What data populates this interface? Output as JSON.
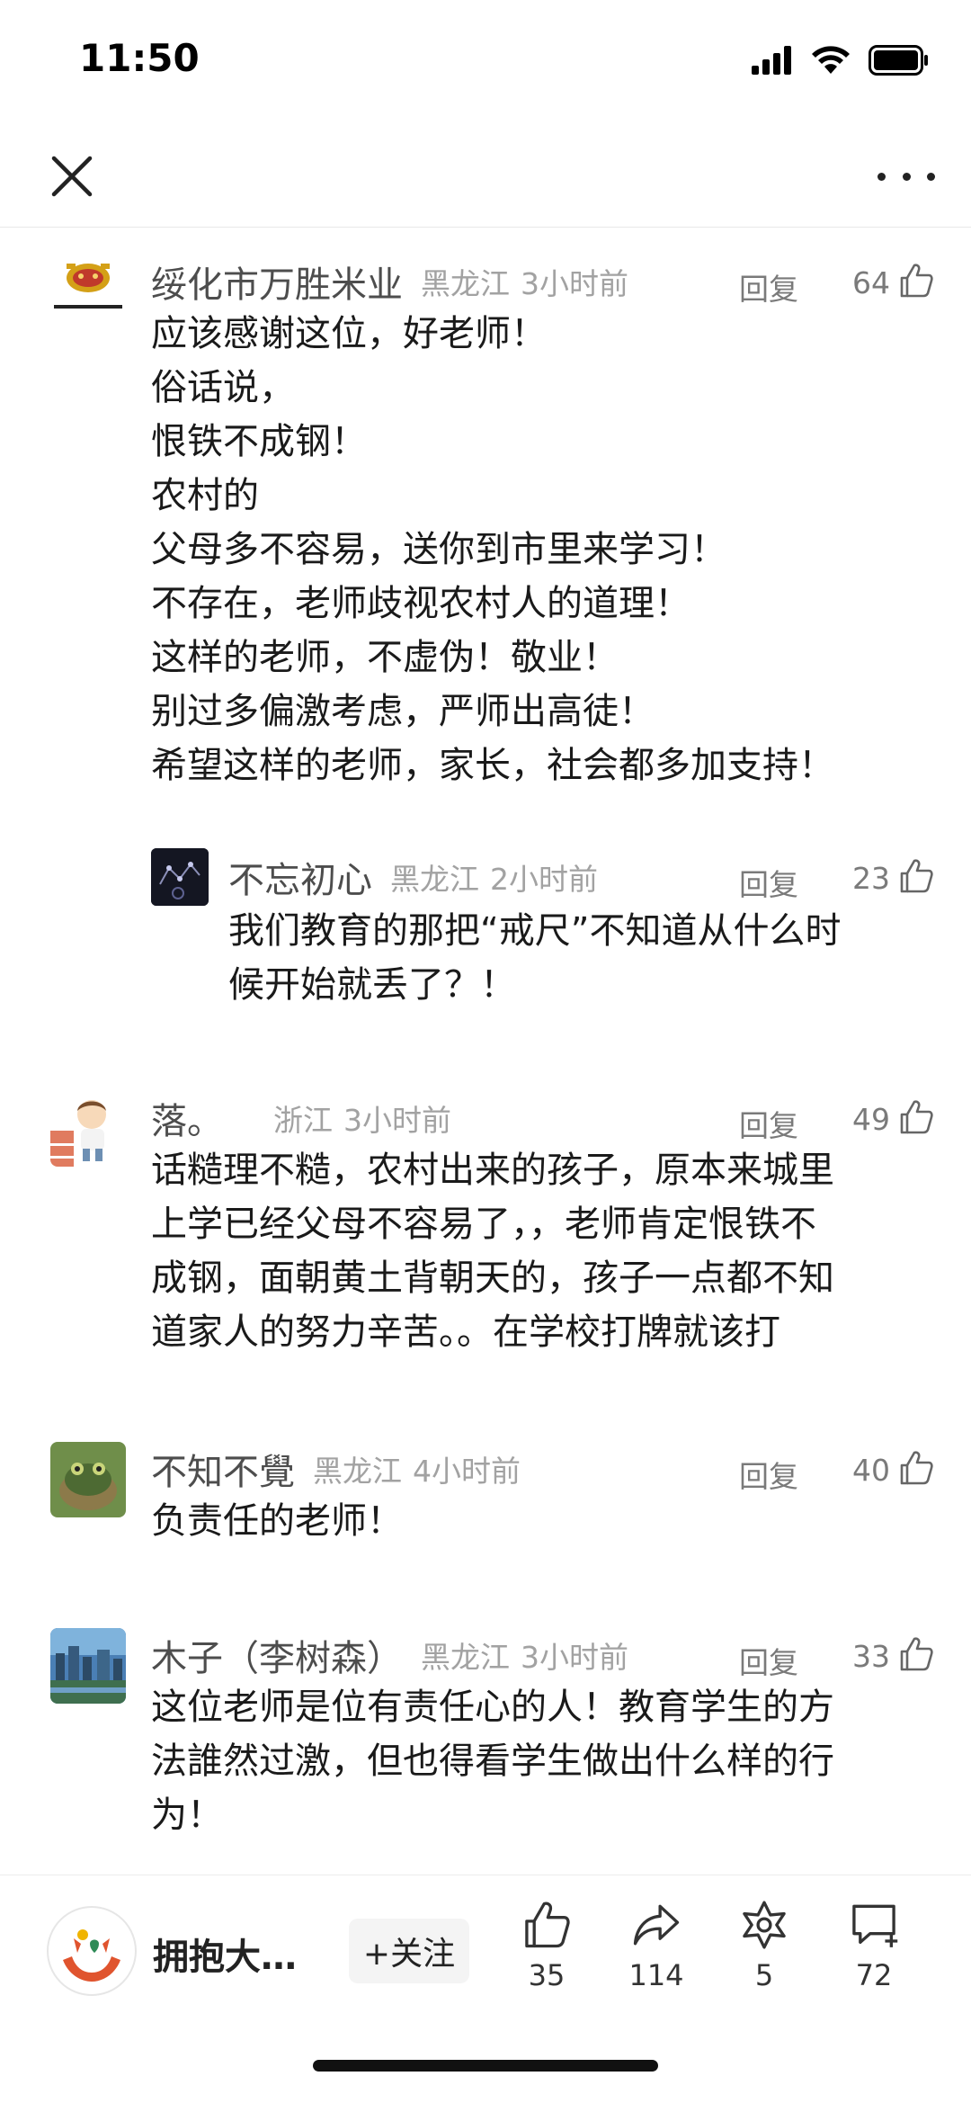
{
  "status": {
    "time": "11:50"
  },
  "comments": [
    {
      "nick": "绥化市万胜米业",
      "location": "黑龙江",
      "time": "3小时前",
      "reply_label": "回复",
      "likes": "64",
      "avatar_text": "黑土双龙",
      "text": "应该感谢这位，好老师！\n俗话说，\n恨铁不成钢！\n农村的\n父母多不容易，送你到市里来学习！\n不存在，老师歧视农村人的道理！\n这样的老师，不虚伪！敬业！\n别过多偏激考虑，严师出高徒！\n希望这样的老师，家长，社会都多加支持！",
      "sub": {
        "nick": "不忘初心",
        "location": "黑龙江",
        "time": "2小时前",
        "reply_label": "回复",
        "likes": "23",
        "text": "我们教育的那把“戒尺”不知道从什么时\n候开始就丢了？！"
      }
    },
    {
      "nick": "落。",
      "location": "浙江",
      "time": "3小时前",
      "reply_label": "回复",
      "likes": "49",
      "text": "话糙理不糙，农村出来的孩子，原本来城里\n上学已经父母不容易了，，老师肯定恨铁不\n成钢，面朝黄土背朝天的，孩子一点都不知\n道家人的努力辛苦。。在学校打牌就该打"
    },
    {
      "nick": "不知不覺",
      "location": "黑龙江",
      "time": "4小时前",
      "reply_label": "回复",
      "likes": "40",
      "text": "负责任的老师！"
    },
    {
      "nick": "木子（李树森）",
      "location": "黑龙江",
      "time": "3小时前",
      "reply_label": "回复",
      "likes": "33",
      "text": "这位老师是位有责任心的人！教育学生的方\n法誰然过激，但也得看学生做出什么样的行\n为！"
    }
  ],
  "bottom": {
    "author_name": "拥抱大…",
    "follow_label": "+关注",
    "like_count": "35",
    "share_count": "114",
    "favorite_count": "5",
    "comment_count": "72"
  }
}
